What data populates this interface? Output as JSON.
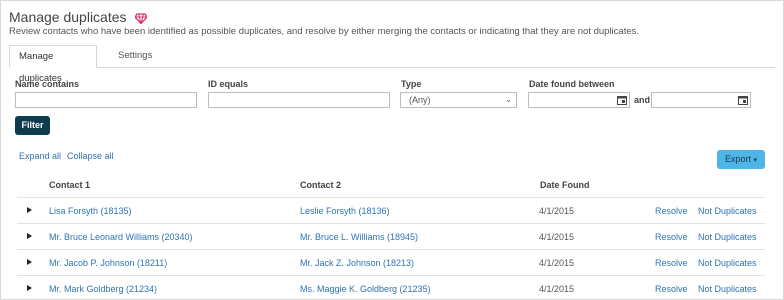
{
  "page": {
    "title": "Manage duplicates",
    "description": "Review contacts who have been identified as possible duplicates, and resolve by either merging the contacts or indicating that they are not duplicates."
  },
  "tabs": [
    {
      "label": "Manage duplicates",
      "active": true
    },
    {
      "label": "Settings",
      "active": false
    }
  ],
  "filters": {
    "name_contains_label": "Name contains",
    "name_contains_value": "",
    "id_equals_label": "ID equals",
    "id_equals_value": "",
    "type_label": "Type",
    "type_value": "(Any)",
    "date_label": "Date found between",
    "and_label": "and",
    "date_from": "",
    "date_to": "",
    "filter_button": "Filter"
  },
  "actions": {
    "expand_all": "Expand all",
    "collapse_all": "Collapse all",
    "export": "Export"
  },
  "table": {
    "headers": {
      "contact1": "Contact 1",
      "contact2": "Contact 2",
      "date_found": "Date Found"
    },
    "rows": [
      {
        "contact1": "Lisa Forsyth (18135)",
        "contact2": "Leslie Forsyth (18136)",
        "date": "4/1/2015",
        "resolve": "Resolve",
        "not_dup": "Not Duplicates"
      },
      {
        "contact1": "Mr. Bruce Leonard Williams (20340)",
        "contact2": "Mr. Bruce L. Williams (18945)",
        "date": "4/1/2015",
        "resolve": "Resolve",
        "not_dup": "Not Duplicates"
      },
      {
        "contact1": "Mr. Jacob P. Johnson (18211)",
        "contact2": "Mr. Jack Z. Johnson (18213)",
        "date": "4/1/2015",
        "resolve": "Resolve",
        "not_dup": "Not Duplicates"
      },
      {
        "contact1": "Mr. Mark Goldberg (21234)",
        "contact2": "Ms. Maggie K. Goldberg (21235)",
        "date": "4/1/2015",
        "resolve": "Resolve",
        "not_dup": "Not Duplicates"
      }
    ]
  },
  "colors": {
    "link": "#2f74b5",
    "filter_button": "#0f3b4f",
    "export_button": "#4db5e8",
    "gem": "#d6336c"
  },
  "icons": {
    "title": "gem-icon",
    "date": "calendar-icon",
    "row": "expand-caret-icon",
    "select": "chevron-down-icon"
  }
}
